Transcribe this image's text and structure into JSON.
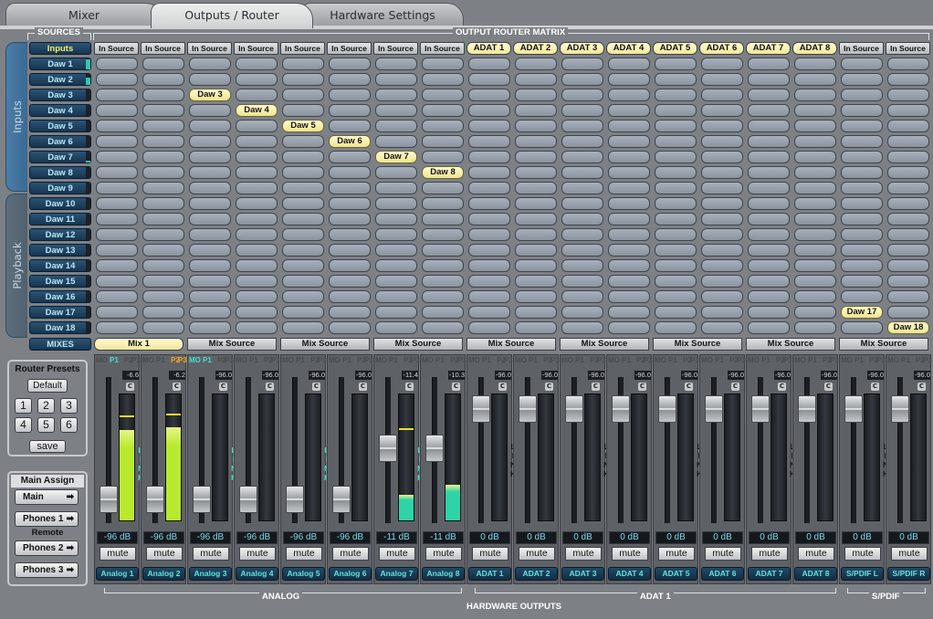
{
  "tabs": [
    "Mixer",
    "Outputs / Router",
    "Hardware Settings"
  ],
  "active_tab": "Outputs / Router",
  "headers": {
    "sources": "SOURCES",
    "matrix": "OUTPUT ROUTER MATRIX",
    "analog": "ANALOG",
    "hardware_outputs": "HARDWARE OUTPUTS",
    "adat1": "ADAT 1",
    "spdif": "S/PDIF"
  },
  "side_tabs": {
    "inputs": "Inputs",
    "playback": "Playback"
  },
  "sources": [
    "Inputs",
    "Daw 1",
    "Daw 2",
    "Daw 3",
    "Daw 4",
    "Daw 5",
    "Daw 6",
    "Daw 7",
    "Daw 8",
    "Daw 9",
    "Daw 10",
    "Daw 11",
    "Daw 12",
    "Daw 13",
    "Daw 14",
    "Daw 15",
    "Daw 16",
    "Daw 17",
    "Daw 18"
  ],
  "mixes_label": "MIXES",
  "source_levels": [
    0,
    0.9,
    0.7,
    0,
    0,
    0,
    0,
    0.2,
    0,
    0,
    0,
    0,
    0,
    0,
    0,
    0,
    0,
    0,
    0
  ],
  "columns": [
    "In Source",
    "In Source",
    "In Source",
    "In Source",
    "In Source",
    "In Source",
    "In Source",
    "In Source",
    "ADAT 1",
    "ADAT 2",
    "ADAT 3",
    "ADAT 4",
    "ADAT 5",
    "ADAT 6",
    "ADAT 7",
    "ADAT 8",
    "In Source",
    "In Source"
  ],
  "routes": [
    {
      "row": 3,
      "col": 2,
      "label": "Daw 3"
    },
    {
      "row": 4,
      "col": 3,
      "label": "Daw 4"
    },
    {
      "row": 5,
      "col": 4,
      "label": "Daw 5"
    },
    {
      "row": 6,
      "col": 5,
      "label": "Daw 6"
    },
    {
      "row": 7,
      "col": 6,
      "label": "Daw 7"
    },
    {
      "row": 8,
      "col": 7,
      "label": "Daw 8"
    },
    {
      "row": 17,
      "col": 16,
      "label": "Daw 17"
    },
    {
      "row": 18,
      "col": 17,
      "label": "Daw 18"
    }
  ],
  "mix_row": [
    "Mix 1",
    "Mix Source",
    "Mix Source",
    "Mix Source",
    "Mix Source",
    "Mix Source",
    "Mix Source",
    "Mix Source",
    "Mix Source"
  ],
  "mix_selectors": [
    "MO",
    "P1",
    "P2",
    "P3"
  ],
  "channels": [
    {
      "name": "Analog 1",
      "readout": "-6.6",
      "db": "-96 dB",
      "level": 0.72,
      "peak": 0.82,
      "fader": 0.15,
      "color": "#b8e92e",
      "linked": true,
      "active": [
        "P1"
      ]
    },
    {
      "name": "Analog 2",
      "readout": "-6.2",
      "db": "-96 dB",
      "level": 0.74,
      "peak": 0.83,
      "fader": 0.15,
      "color": "#b8e92e",
      "linked": false,
      "active": [
        "P2",
        "P3"
      ]
    },
    {
      "name": "Analog 3",
      "readout": "-96.0",
      "db": "-96 dB",
      "level": 0,
      "peak": 0,
      "fader": 0.15,
      "color": "#2fc6b3",
      "linked": true,
      "active": [
        "MO",
        "P1"
      ]
    },
    {
      "name": "Analog 4",
      "readout": "-96.0",
      "db": "-96 dB",
      "level": 0,
      "peak": 0,
      "fader": 0.15,
      "color": "#2fc6b3",
      "linked": false,
      "active": []
    },
    {
      "name": "Analog 5",
      "readout": "-96.0",
      "db": "-96 dB",
      "level": 0,
      "peak": 0,
      "fader": 0.15,
      "color": "#2fc6b3",
      "linked": true,
      "active": []
    },
    {
      "name": "Analog 6",
      "readout": "-96.0",
      "db": "-96 dB",
      "level": 0,
      "peak": 0,
      "fader": 0.15,
      "color": "#2fc6b3",
      "linked": false,
      "active": []
    },
    {
      "name": "Analog 7",
      "readout": "-11.4",
      "db": "-11 dB",
      "level": 0.2,
      "peak": 0.72,
      "fader": 0.55,
      "color": "#2ed3a8",
      "linked": true,
      "active": []
    },
    {
      "name": "Analog 8",
      "readout": "-10.3",
      "db": "-11 dB",
      "level": 0.28,
      "peak": 0,
      "fader": 0.55,
      "color": "#2ed3a8",
      "linked": false,
      "active": []
    },
    {
      "name": "ADAT 1",
      "readout": "-96.0",
      "db": "0 dB",
      "level": 0,
      "peak": 0,
      "fader": 0.86,
      "color": "#2fc6b3",
      "linked": true,
      "active": []
    },
    {
      "name": "ADAT 2",
      "readout": "-96.0",
      "db": "0 dB",
      "level": 0,
      "peak": 0,
      "fader": 0.86,
      "color": "#2fc6b3",
      "linked": false,
      "active": []
    },
    {
      "name": "ADAT 3",
      "readout": "-96.0",
      "db": "0 dB",
      "level": 0,
      "peak": 0,
      "fader": 0.86,
      "color": "#2fc6b3",
      "linked": true,
      "active": []
    },
    {
      "name": "ADAT 4",
      "readout": "-96.0",
      "db": "0 dB",
      "level": 0,
      "peak": 0,
      "fader": 0.86,
      "color": "#2fc6b3",
      "linked": false,
      "active": []
    },
    {
      "name": "ADAT 5",
      "readout": "-96.0",
      "db": "0 dB",
      "level": 0,
      "peak": 0,
      "fader": 0.86,
      "color": "#2fc6b3",
      "linked": true,
      "active": []
    },
    {
      "name": "ADAT 6",
      "readout": "-96.0",
      "db": "0 dB",
      "level": 0,
      "peak": 0,
      "fader": 0.86,
      "color": "#2fc6b3",
      "linked": false,
      "active": []
    },
    {
      "name": "ADAT 7",
      "readout": "-96.0",
      "db": "0 dB",
      "level": 0,
      "peak": 0,
      "fader": 0.86,
      "color": "#2fc6b3",
      "linked": true,
      "active": []
    },
    {
      "name": "ADAT 8",
      "readout": "-96.0",
      "db": "0 dB",
      "level": 0,
      "peak": 0,
      "fader": 0.86,
      "color": "#2fc6b3",
      "linked": false,
      "active": []
    },
    {
      "name": "S/PDIF L",
      "readout": "-96.0",
      "db": "0 dB",
      "level": 0,
      "peak": 0,
      "fader": 0.86,
      "color": "#2fc6b3",
      "linked": true,
      "active": []
    },
    {
      "name": "S/PDIF R",
      "readout": "-96.0",
      "db": "0 dB",
      "level": 0,
      "peak": 0,
      "fader": 0.86,
      "color": "#2fc6b3",
      "linked": false,
      "active": []
    }
  ],
  "link_letters": [
    "L",
    "I",
    "N",
    "K"
  ],
  "mute_label": "mute",
  "c_label": "C",
  "router_presets": {
    "title": "Router Presets",
    "default": "Default",
    "presets": [
      "1",
      "2",
      "3",
      "4",
      "5",
      "6"
    ],
    "save": "save"
  },
  "main_assign": {
    "title": "Main Assign",
    "items": [
      "Main",
      "Phones 1",
      "Phones 2",
      "Phones 3"
    ],
    "remote": "Remote"
  },
  "arrow": "➡",
  "colors": {
    "link_analog": "#3ee2c4",
    "link_adat": "#111111",
    "accent_yellow": "#f2ef6b",
    "tab_blue": "#3f6f98"
  }
}
